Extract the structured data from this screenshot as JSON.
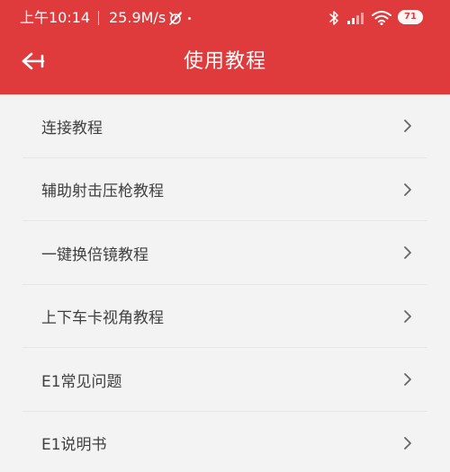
{
  "status_bar": {
    "time": "上午10:14",
    "speed": "25.9M/s",
    "battery": "71",
    "icons": [
      "alarm-off-icon",
      "bluetooth-icon",
      "signal-icon",
      "wifi-icon",
      "battery-icon"
    ]
  },
  "header": {
    "title": "使用教程",
    "back_icon": "back-arrow-icon",
    "background_color": "#df3b3d"
  },
  "menu": {
    "items": [
      {
        "label": "连接教程"
      },
      {
        "label": "辅助射击压枪教程"
      },
      {
        "label": "一键换倍镜教程"
      },
      {
        "label": "上下车卡视角教程"
      },
      {
        "label": "E1常见问题"
      },
      {
        "label": "E1说明书"
      }
    ],
    "chevron_icon": "chevron-right-icon"
  }
}
